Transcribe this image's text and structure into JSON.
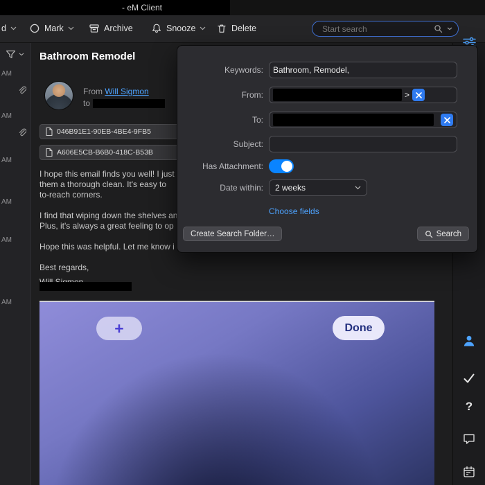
{
  "titlebar": {
    "title": "- eM Client"
  },
  "toolbar": {
    "partial_label": "d",
    "mark_label": "Mark",
    "archive_label": "Archive",
    "snooze_label": "Snooze",
    "delete_label": "Delete",
    "search_placeholder": "Start search"
  },
  "message_list": {
    "times": [
      "AM",
      "AM",
      "AM",
      "AM",
      "AM",
      "AM"
    ]
  },
  "email": {
    "subject": "Bathroom Remodel",
    "from_label": "From",
    "sender_name": "Will Sigmon",
    "to_label": "to",
    "attachments": [
      "046B91E1-90EB-4BE4-9FB5",
      "A606E5CB-B6B0-418C-B53B"
    ],
    "body_lines": [
      "I hope this email finds you well! I just",
      "them a thorough clean. It's easy to",
      "to-reach corners.",
      "I find that wiping down the shelves an",
      "Plus, it's always a great feeling to op",
      "Hope this was helpful. Let me know i",
      "Best regards,",
      "Will Sigmon"
    ]
  },
  "search_panel": {
    "keywords_label": "Keywords:",
    "keywords_value": "Bathroom, Remodel,",
    "from_label": "From:",
    "from_token_suffix": ">",
    "to_label": "To:",
    "subject_label": "Subject:",
    "subject_value": "",
    "has_attachment_label": "Has Attachment:",
    "has_attachment_on": true,
    "date_within_label": "Date within:",
    "date_within_value": "2 weeks",
    "choose_fields_label": "Choose fields",
    "create_folder_label": "Create Search Folder…",
    "search_label": "Search"
  },
  "embedded_image": {
    "add_label": "+",
    "done_label": "Done"
  },
  "sidebar_icons": {
    "help_glyph": "?"
  },
  "colors": {
    "accent_blue": "#2f7bf0",
    "link_blue": "#4da3ff",
    "toggle_on": "#0a84ff"
  }
}
